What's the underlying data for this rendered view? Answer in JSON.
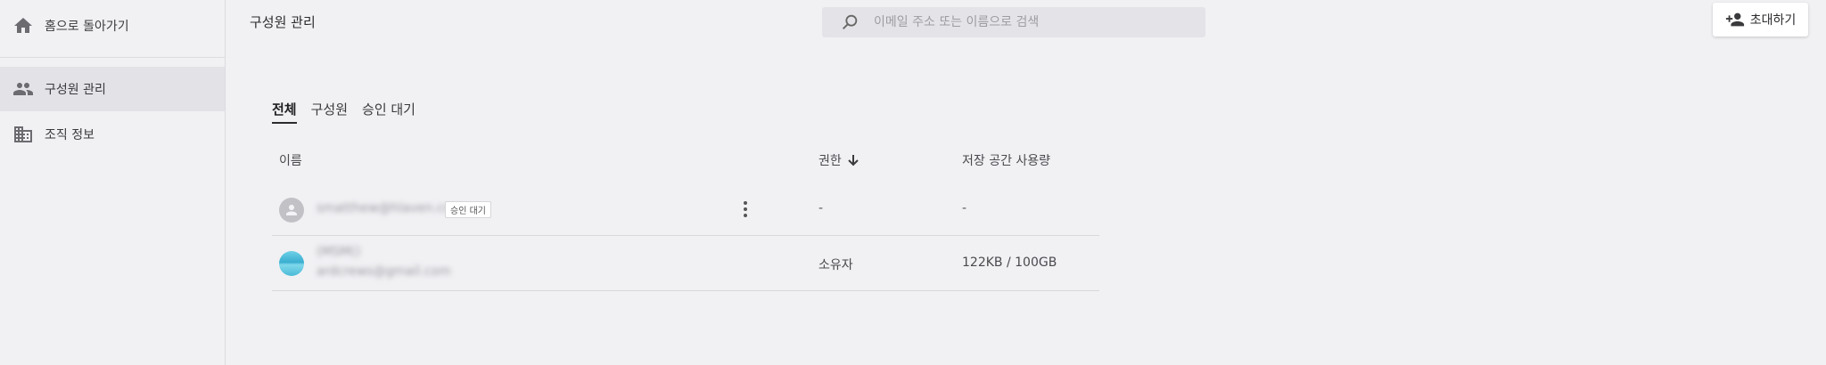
{
  "sidebar": {
    "home_label": "홈으로 돌아가기",
    "items": [
      {
        "label": "구성원 관리",
        "icon": "people-icon",
        "active": true
      },
      {
        "label": "조직 정보",
        "icon": "building-icon",
        "active": false
      }
    ]
  },
  "header": {
    "title": "구성원 관리",
    "search_placeholder": "이메일 주소 또는 이름으로 검색",
    "invite_label": "초대하기"
  },
  "tabs": [
    {
      "label": "전체",
      "active": true
    },
    {
      "label": "구성원",
      "active": false
    },
    {
      "label": "승인 대기",
      "active": false
    }
  ],
  "table": {
    "columns": {
      "name": "이름",
      "role": "권한",
      "storage": "저장 공간 사용량"
    },
    "rows": [
      {
        "email": "smatthew@hlaven.com",
        "badge": "승인 대기",
        "role": "-",
        "storage": "-"
      },
      {
        "name": "(MSM()",
        "email": "ardcrews@gmail.com",
        "role": "소유자",
        "storage": "122KB / 100GB"
      }
    ]
  }
}
